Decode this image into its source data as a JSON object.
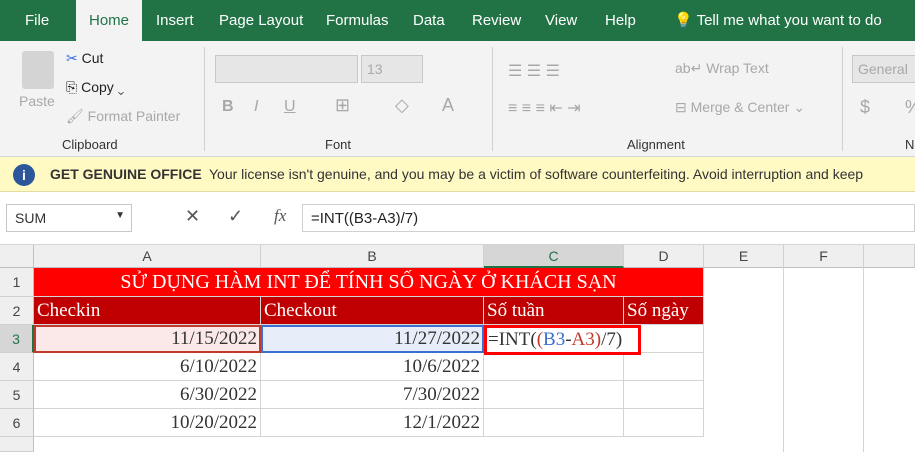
{
  "tabs": [
    "File",
    "Home",
    "Insert",
    "Page Layout",
    "Formulas",
    "Data",
    "Review",
    "View",
    "Help"
  ],
  "tell_me": "Tell me what you want to do",
  "ribbon": {
    "paste": "Paste",
    "cut": "Cut",
    "copy": "Copy",
    "format_painter": "Format Painter",
    "clipboard": "Clipboard",
    "font_size": "13",
    "font": "Font",
    "bold": "B",
    "italic": "I",
    "underline": "U",
    "wrap_text": "Wrap Text",
    "merge_center": "Merge & Center",
    "alignment": "Alignment",
    "number_format": "General",
    "currency": "$",
    "percent": "%",
    "number": "N"
  },
  "message": {
    "title": "GET GENUINE OFFICE",
    "text": "Your license isn't genuine, and you may be a victim of software counterfeiting. Avoid interruption and keep"
  },
  "formula_bar": {
    "name_box": "SUM",
    "fx": "fx",
    "formula": "=INT((B3-A3)/7)"
  },
  "columns": [
    "A",
    "B",
    "C",
    "D",
    "E",
    "F"
  ],
  "rows": [
    "1",
    "2",
    "3",
    "4",
    "5",
    "6"
  ],
  "sheet": {
    "title": "SỬ DỤNG HÀM INT ĐỂ TÍNH SỐ NGÀY Ở KHÁCH SẠN",
    "headers": [
      "Checkin",
      "Checkout",
      "Số tuần",
      "Số ngày"
    ],
    "data": [
      [
        "11/15/2022",
        "11/27/2022"
      ],
      [
        "6/10/2022",
        "10/6/2022"
      ],
      [
        "6/30/2022",
        "7/30/2022"
      ],
      [
        "10/20/2022",
        "12/1/2022"
      ]
    ],
    "edit": {
      "p1": "=INT(",
      "p2": "(",
      "ref1": "B3",
      "p3": "-",
      "ref2": "A3",
      "p4": ")",
      "p5": "/7)"
    }
  },
  "colors": {
    "title_bg": "#ff0000",
    "header_bg": "#c00000",
    "excel_green": "#217346",
    "ref_blue": "#3a6fcf",
    "ref_red": "#c0392b"
  }
}
